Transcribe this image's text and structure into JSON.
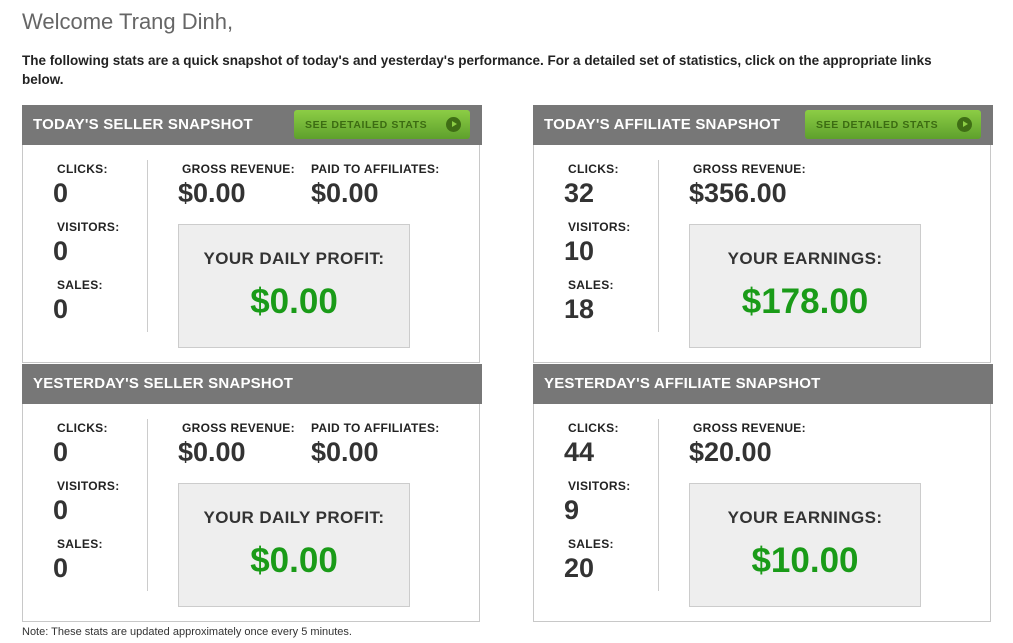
{
  "welcome": "Welcome Trang Dinh,",
  "intro": "The following stats are a quick snapshot of today's and yesterday's performance. For a detailed set of statistics, click on the appropriate links below.",
  "labels": {
    "clicks": "CLICKS:",
    "visitors": "VISITORS:",
    "sales": "SALES:",
    "gross": "GROSS REVENUE:",
    "paid": "PAID TO AFFILIATES:",
    "daily_profit": "YOUR DAILY PROFIT:",
    "earnings": "YOUR EARNINGS:",
    "see_stats": "SEE DETAILED STATS"
  },
  "today_seller": {
    "title": "TODAY'S SELLER SNAPSHOT",
    "clicks": "0",
    "visitors": "0",
    "sales": "0",
    "gross": "$0.00",
    "paid": "$0.00",
    "profit": "$0.00"
  },
  "today_affiliate": {
    "title": "TODAY'S AFFILIATE SNAPSHOT",
    "clicks": "32",
    "visitors": "10",
    "sales": "18",
    "gross": "$356.00",
    "earnings": "$178.00"
  },
  "yesterday_seller": {
    "title": "YESTERDAY'S SELLER SNAPSHOT",
    "clicks": "0",
    "visitors": "0",
    "sales": "0",
    "gross": "$0.00",
    "paid": "$0.00",
    "profit": "$0.00"
  },
  "yesterday_affiliate": {
    "title": "YESTERDAY'S AFFILIATE SNAPSHOT",
    "clicks": "44",
    "visitors": "9",
    "sales": "20",
    "gross": "$20.00",
    "earnings": "$10.00"
  },
  "note": "Note: These stats are updated approximately once every 5 minutes.",
  "colors": {
    "header_bg": "#777777",
    "button_green": "#6aaf33",
    "value_green": "#1a9b18"
  }
}
